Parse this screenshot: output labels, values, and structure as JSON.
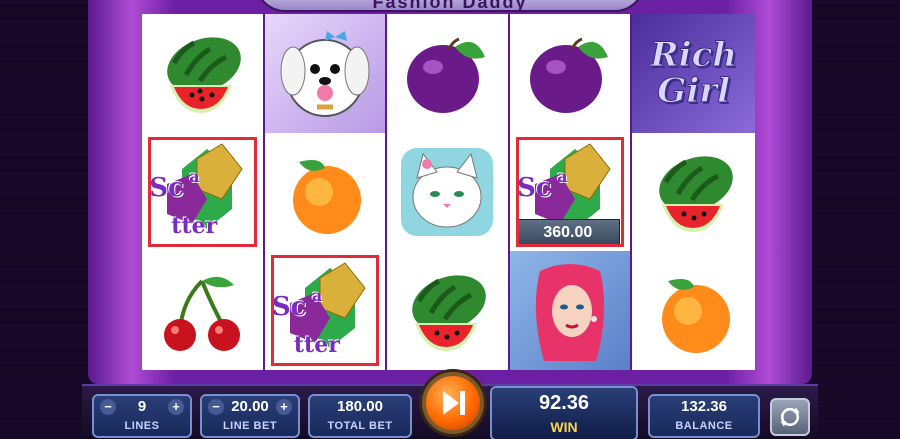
{
  "game": {
    "title": "Fashion Daddy"
  },
  "reels": [
    [
      {
        "symbol": "watermelon-icon"
      },
      {
        "symbol": "dog-icon"
      },
      {
        "symbol": "plum-icon"
      },
      {
        "symbol": "plum-icon"
      },
      {
        "symbol": "rich-girl-logo",
        "text_line1": "Rich",
        "text_line2": "Girl"
      }
    ],
    [
      {
        "symbol": "scatter-icon",
        "highlighted": true
      },
      {
        "symbol": "peach-icon"
      },
      {
        "symbol": "cat-icon"
      },
      {
        "symbol": "scatter-icon",
        "highlighted": true,
        "win_amount": "360.00"
      },
      {
        "symbol": "watermelon-icon"
      }
    ],
    [
      {
        "symbol": "cherry-icon"
      },
      {
        "symbol": "scatter-icon",
        "highlighted": true
      },
      {
        "symbol": "watermelon-icon"
      },
      {
        "symbol": "girl-portrait"
      },
      {
        "symbol": "peach-icon"
      }
    ]
  ],
  "scatter_text": {
    "sc": "Sc",
    "a": "a",
    "tter": "tter"
  },
  "win_tag": "360.00",
  "console": {
    "lines": {
      "value": "9",
      "label": "LINES",
      "minus": "−",
      "plus": "+"
    },
    "line_bet": {
      "value": "20.00",
      "label": "LINE BET",
      "minus": "−",
      "plus": "+"
    },
    "total_bet": {
      "value": "180.00",
      "label": "TOTAL BET"
    },
    "win": {
      "value": "92.36",
      "label": "WIN"
    },
    "balance": {
      "value": "132.36",
      "label": "BALANCE"
    }
  },
  "side_gems": {
    "left": [
      "#e63de0",
      "#2a6cff",
      "#e0202a",
      "#2a6cff",
      "#e63de0"
    ],
    "right": [
      "#2a6cff",
      "#2fd43a",
      "#f7d21a",
      "#ff4a1a"
    ]
  },
  "colors": {
    "frame": "#6b1fa3",
    "highlight": "#e02c3a",
    "spin": "#ff6a00",
    "win_label": "#f7d64a"
  }
}
